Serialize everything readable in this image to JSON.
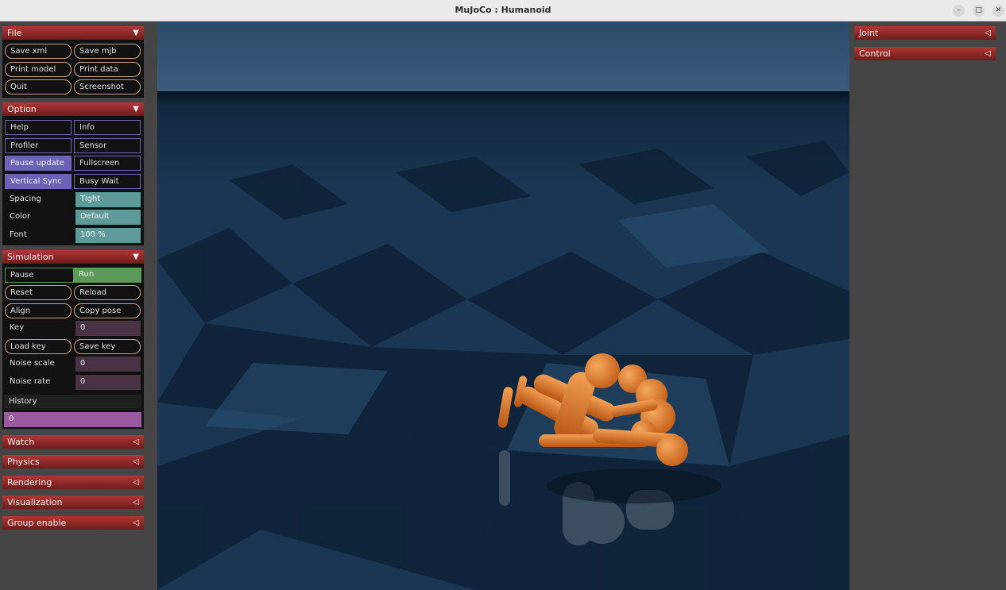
{
  "window": {
    "title": "MuJoCo : Humanoid"
  },
  "file": {
    "header": "File",
    "buttons": [
      "Save xml",
      "Save mjb",
      "Print model",
      "Print data",
      "Quit",
      "Screenshot"
    ]
  },
  "option": {
    "header": "Option",
    "help": "Help",
    "info": "Info",
    "profiler": "Profiler",
    "sensor": "Sensor",
    "pause_update": "Pause update",
    "fullscreen": "Fullscreen",
    "vertical_sync": "Vertical Sync",
    "busy_wait": "Busy Wait",
    "spacing_label": "Spacing",
    "spacing_value": "Tight",
    "color_label": "Color",
    "color_value": "Default",
    "font_label": "Font",
    "font_value": "100 %"
  },
  "simulation": {
    "header": "Simulation",
    "pause": "Pause",
    "run": "Run",
    "reset": "Reset",
    "reload": "Reload",
    "align": "Align",
    "copy_pose": "Copy pose",
    "key_label": "Key",
    "key_value": "0",
    "load_key": "Load key",
    "save_key": "Save key",
    "noise_scale_label": "Noise scale",
    "noise_scale_value": "0",
    "noise_rate_label": "Noise rate",
    "noise_rate_value": "0",
    "history_label": "History",
    "history_value": "0"
  },
  "collapsed_sections": [
    "Watch",
    "Physics",
    "Rendering",
    "Visualization",
    "Group enable"
  ],
  "right_sections": [
    "Joint",
    "Control"
  ],
  "icons": {
    "expanded": "▼",
    "collapsed": "◁"
  },
  "colors": {
    "section_header": "#8e2424",
    "accent_purple": "#6a62b6",
    "teal": "#5f9a9a",
    "run_green": "#5c9a5c",
    "history": "#9a5aa0",
    "humanoid": "#e0782a"
  }
}
